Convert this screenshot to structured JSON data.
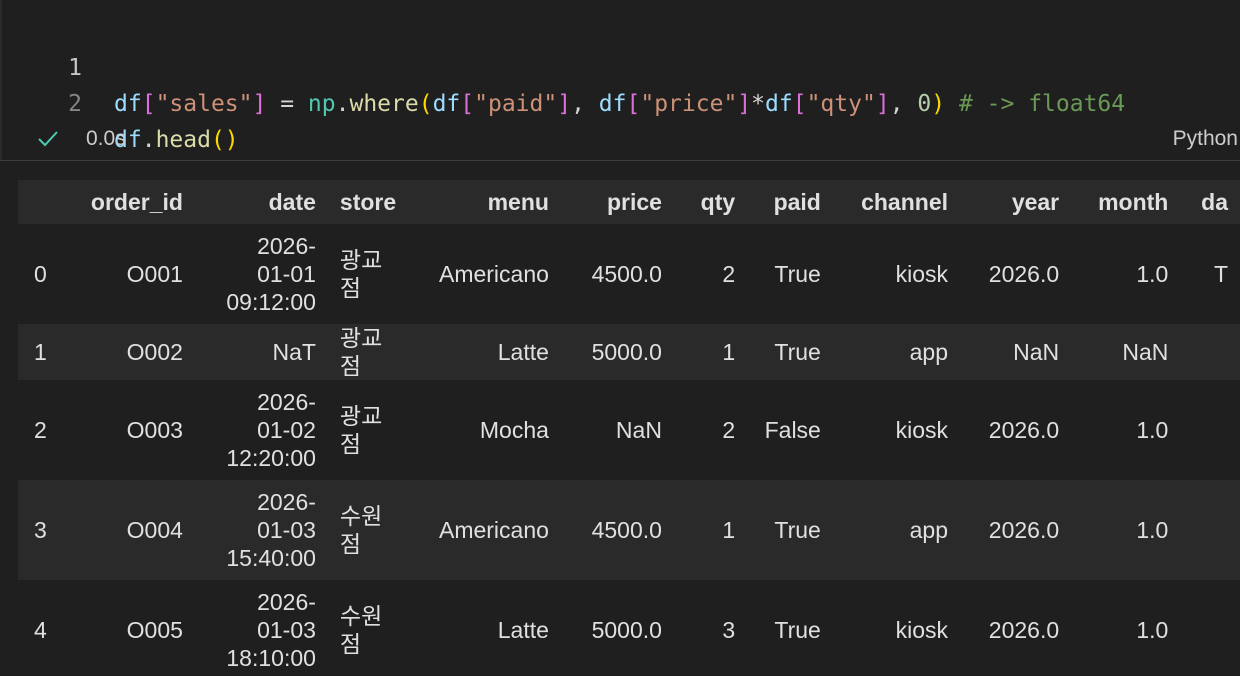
{
  "code": {
    "line_numbers": [
      "1",
      "2"
    ],
    "line1_tokens": [
      {
        "t": "df",
        "c": "t-var"
      },
      {
        "t": "[",
        "c": "t-br1"
      },
      {
        "t": "\"sales\"",
        "c": "t-str"
      },
      {
        "t": "]",
        "c": "t-br1"
      },
      {
        "t": " = ",
        "c": "t-op"
      },
      {
        "t": "np",
        "c": "t-mod"
      },
      {
        "t": ".",
        "c": "t-op"
      },
      {
        "t": "where",
        "c": "t-fn"
      },
      {
        "t": "(",
        "c": "t-br0"
      },
      {
        "t": "df",
        "c": "t-var"
      },
      {
        "t": "[",
        "c": "t-br1"
      },
      {
        "t": "\"paid\"",
        "c": "t-str"
      },
      {
        "t": "]",
        "c": "t-br1"
      },
      {
        "t": ", ",
        "c": "t-op"
      },
      {
        "t": "df",
        "c": "t-var"
      },
      {
        "t": "[",
        "c": "t-br1"
      },
      {
        "t": "\"price\"",
        "c": "t-str"
      },
      {
        "t": "]",
        "c": "t-br1"
      },
      {
        "t": "*",
        "c": "t-op"
      },
      {
        "t": "df",
        "c": "t-var"
      },
      {
        "t": "[",
        "c": "t-br1"
      },
      {
        "t": "\"qty\"",
        "c": "t-str"
      },
      {
        "t": "]",
        "c": "t-br1"
      },
      {
        "t": ", ",
        "c": "t-op"
      },
      {
        "t": "0",
        "c": "t-num"
      },
      {
        "t": ")",
        "c": "t-br0"
      },
      {
        "t": " # -> float64",
        "c": "t-com"
      }
    ],
    "line2_tokens": [
      {
        "t": "df",
        "c": "t-var"
      },
      {
        "t": ".",
        "c": "t-op"
      },
      {
        "t": "head",
        "c": "t-fn"
      },
      {
        "t": "()",
        "c": "t-br0"
      }
    ]
  },
  "status": {
    "icon": "check-icon",
    "exec_time": "0.0s",
    "kernel": "Python",
    "check_color": "#4ec9b0"
  },
  "table": {
    "columns": [
      "",
      "order_id",
      "date",
      "store",
      "menu",
      "price",
      "qty",
      "paid",
      "channel",
      "year",
      "month",
      "da"
    ],
    "rows": [
      [
        "0",
        "O001",
        "2026-\n01-01\n09:12:00",
        "광교점",
        "Americano",
        "4500.0",
        "2",
        "True",
        "kiosk",
        "2026.0",
        "1.0",
        "T"
      ],
      [
        "1",
        "O002",
        "NaT",
        "광교점",
        "Latte",
        "5000.0",
        "1",
        "True",
        "app",
        "NaN",
        "NaN",
        ""
      ],
      [
        "2",
        "O003",
        "2026-\n01-02\n12:20:00",
        "광교점",
        "Mocha",
        "NaN",
        "2",
        "False",
        "kiosk",
        "2026.0",
        "1.0",
        ""
      ],
      [
        "3",
        "O004",
        "2026-\n01-03\n15:40:00",
        "수원점",
        "Americano",
        "4500.0",
        "1",
        "True",
        "app",
        "2026.0",
        "1.0",
        ""
      ],
      [
        "4",
        "O005",
        "2026-\n01-03\n18:10:00",
        "수원점",
        "Latte",
        "5000.0",
        "3",
        "True",
        "kiosk",
        "2026.0",
        "1.0",
        ""
      ]
    ]
  }
}
